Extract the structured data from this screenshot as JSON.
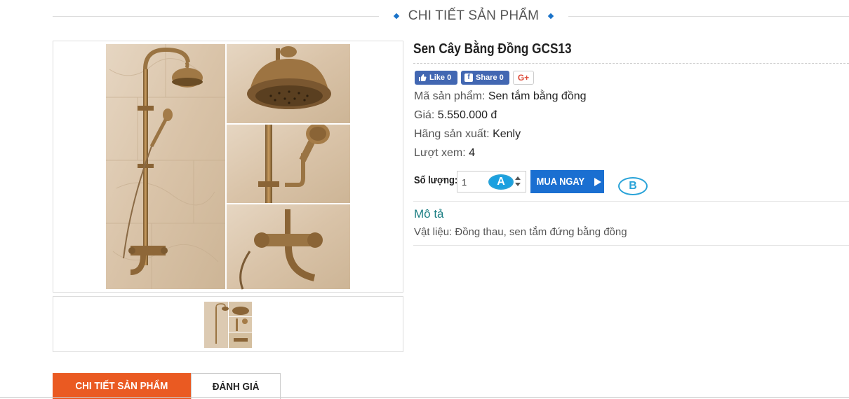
{
  "section_header": "CHI TIẾT SẢN PHẨM",
  "product": {
    "title": "Sen Cây Bằng Đồng GCS13",
    "social": {
      "like": "Like 0",
      "share": "Share 0",
      "gplus": "G+"
    },
    "fields": [
      {
        "label": "Mã sản phẩm:",
        "value": "Sen tắm bằng đồng"
      },
      {
        "label": "Giá:",
        "value": "5.550.000 đ"
      },
      {
        "label": "Hãng sản xuất:",
        "value": "Kenly"
      },
      {
        "label": "Lượt xem:",
        "value": "4"
      }
    ],
    "quantity_label": "Số lượng:",
    "quantity_value": "1",
    "buy_button": "MUA NGAY",
    "markers": {
      "a": "A",
      "b": "B"
    },
    "description_title": "Mô tả",
    "description_text": "Vật liệu: Đồng thau, sen tắm đứng bằng đồng"
  },
  "tabs": [
    "CHI TIẾT SẢN PHẨM",
    "ĐÁNH GIÁ"
  ],
  "colors": {
    "accent_blue": "#1a6fd1",
    "tab_active": "#ea5a22",
    "description_title": "#1d7f84",
    "facebook": "#4267b2"
  }
}
